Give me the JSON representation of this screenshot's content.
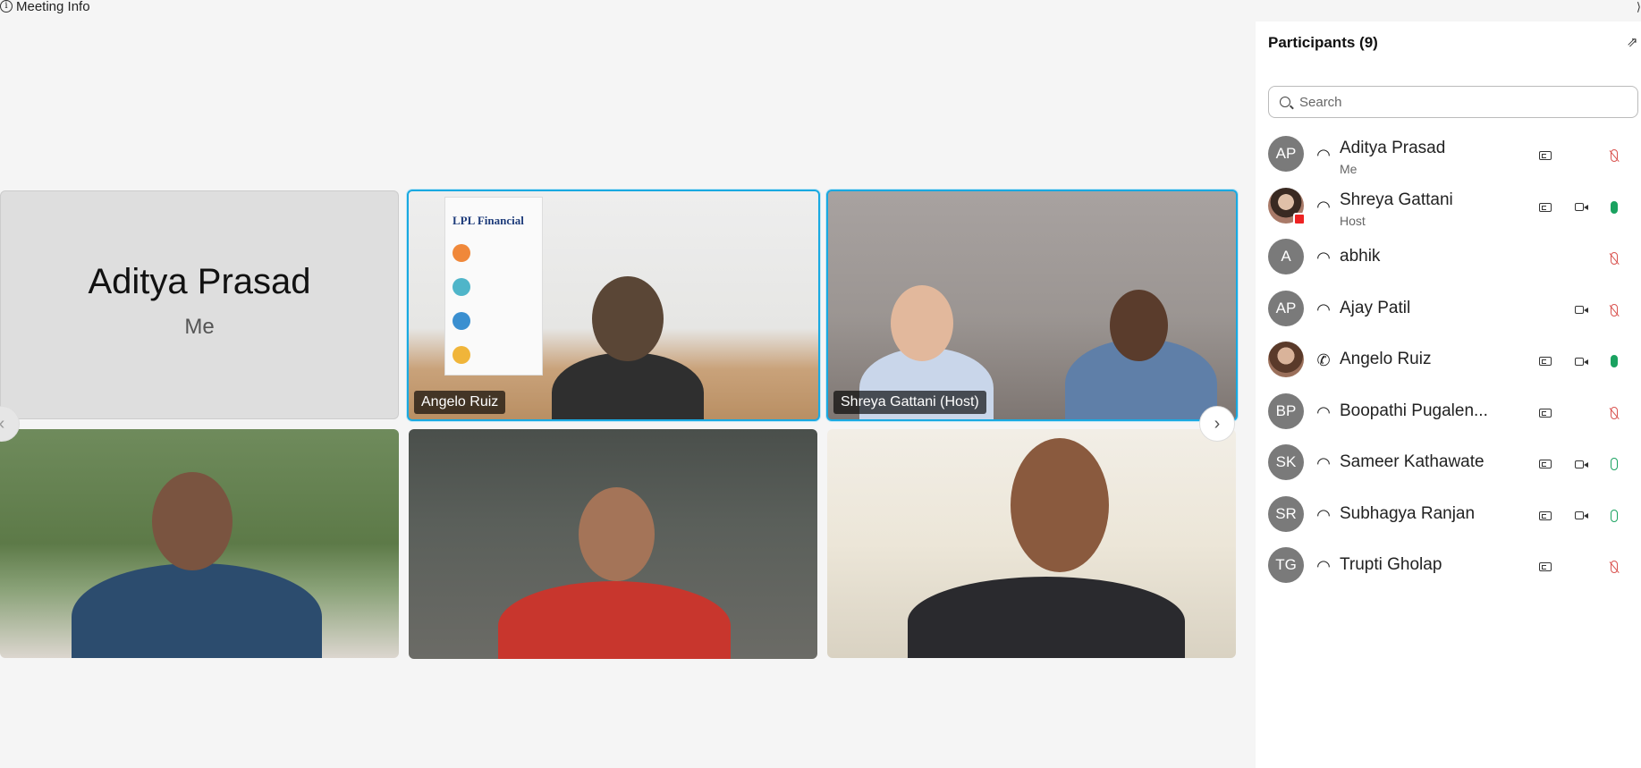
{
  "meeting": {
    "info_label": "Meeting Info",
    "info_glyph": "i",
    "corner_glyph": "⟩"
  },
  "stage": {
    "me_tile": {
      "name": "Aditya Prasad",
      "sub": "Me"
    },
    "tiles": [
      {
        "label": "Angelo Ruiz",
        "banner_title": "LPL Financial"
      },
      {
        "label": "Shreya Gattani (Host)"
      }
    ],
    "prev_glyph": "‹",
    "next_glyph": "›"
  },
  "participants": {
    "title": "Participants (9)",
    "search_placeholder": "Search",
    "list": [
      {
        "initials": "AP",
        "name": "Aditya Prasad",
        "role": "Me",
        "audio": "headset",
        "cc": true,
        "cam": false,
        "mic": "muted"
      },
      {
        "initials": "",
        "name": "Shreya Gattani",
        "role": "Host",
        "audio": "headset",
        "cc": true,
        "cam": true,
        "mic": "on",
        "photo": true,
        "recording": true
      },
      {
        "initials": "A",
        "name": "abhik",
        "role": "",
        "audio": "headset",
        "cc": false,
        "cam": false,
        "mic": "muted"
      },
      {
        "initials": "AP",
        "name": "Ajay Patil",
        "role": "",
        "audio": "headset",
        "cc": false,
        "cam": true,
        "mic": "muted"
      },
      {
        "initials": "",
        "name": "Angelo Ruiz",
        "role": "",
        "audio": "phone",
        "cc": true,
        "cam": true,
        "mic": "on",
        "photo": true
      },
      {
        "initials": "BP",
        "name": "Boopathi Pugalen...",
        "role": "",
        "audio": "headset",
        "cc": true,
        "cam": false,
        "mic": "muted"
      },
      {
        "initials": "SK",
        "name": "Sameer Kathawate",
        "role": "",
        "audio": "headset",
        "cc": true,
        "cam": true,
        "mic": "idle"
      },
      {
        "initials": "SR",
        "name": "Subhagya Ranjan",
        "role": "",
        "audio": "headset",
        "cc": true,
        "cam": true,
        "mic": "idle"
      },
      {
        "initials": "TG",
        "name": "Trupti Gholap",
        "role": "",
        "audio": "headset",
        "cc": true,
        "cam": false,
        "mic": "muted"
      }
    ]
  },
  "colors": {
    "active_border": "#19a9e1",
    "muted": "#d9534f",
    "unmuted": "#1aa260",
    "avatar_bg": "#7a7a7a"
  }
}
